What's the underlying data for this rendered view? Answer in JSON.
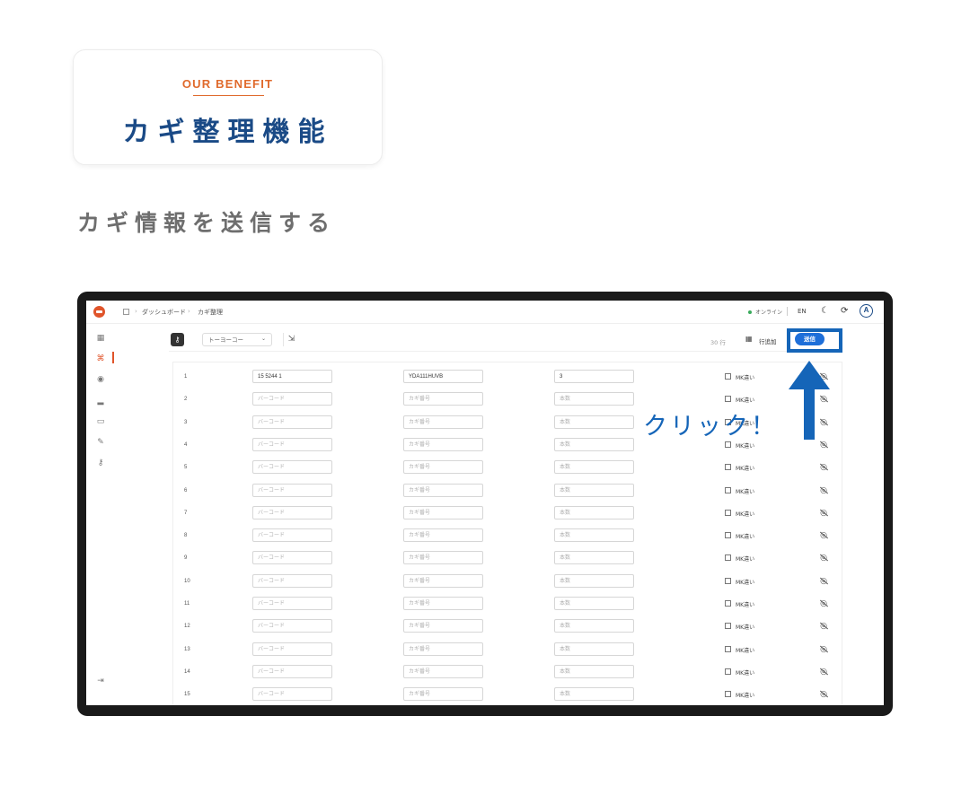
{
  "hero": {
    "eyebrow": "OUR BENEFIT",
    "title": "カギ整理機能",
    "section_title": "カギ情報を送信する"
  },
  "app": {
    "breadcrumb": [
      "ダッシュボード",
      "カギ整理"
    ],
    "status": "オンライン",
    "language": "EN",
    "avatar_initial": "A",
    "toolbar": {
      "select_value": "トーヨーコー",
      "row_count": "30 行",
      "add_row_label": "行追加",
      "send_label": "送信"
    },
    "table": {
      "placeholders": {
        "barcode": "バーコード",
        "key_number": "カギ番号",
        "count": "本数"
      },
      "checkbox_label": "MK違い",
      "rows": [
        {
          "num": "1",
          "barcode": "15 5244 1",
          "key_number": "YDA111HUVB",
          "count": "3"
        },
        {
          "num": "2"
        },
        {
          "num": "3"
        },
        {
          "num": "4"
        },
        {
          "num": "5"
        },
        {
          "num": "6"
        },
        {
          "num": "7"
        },
        {
          "num": "8"
        },
        {
          "num": "9"
        },
        {
          "num": "10"
        },
        {
          "num": "11"
        },
        {
          "num": "12"
        },
        {
          "num": "13"
        },
        {
          "num": "14"
        },
        {
          "num": "15"
        }
      ]
    }
  },
  "annotation": {
    "callout": "クリック！"
  },
  "colors": {
    "accent_orange": "#e06a2c",
    "navy": "#1a4a86",
    "callout_blue": "#1565b8",
    "send_blue": "#1e6fd9"
  }
}
